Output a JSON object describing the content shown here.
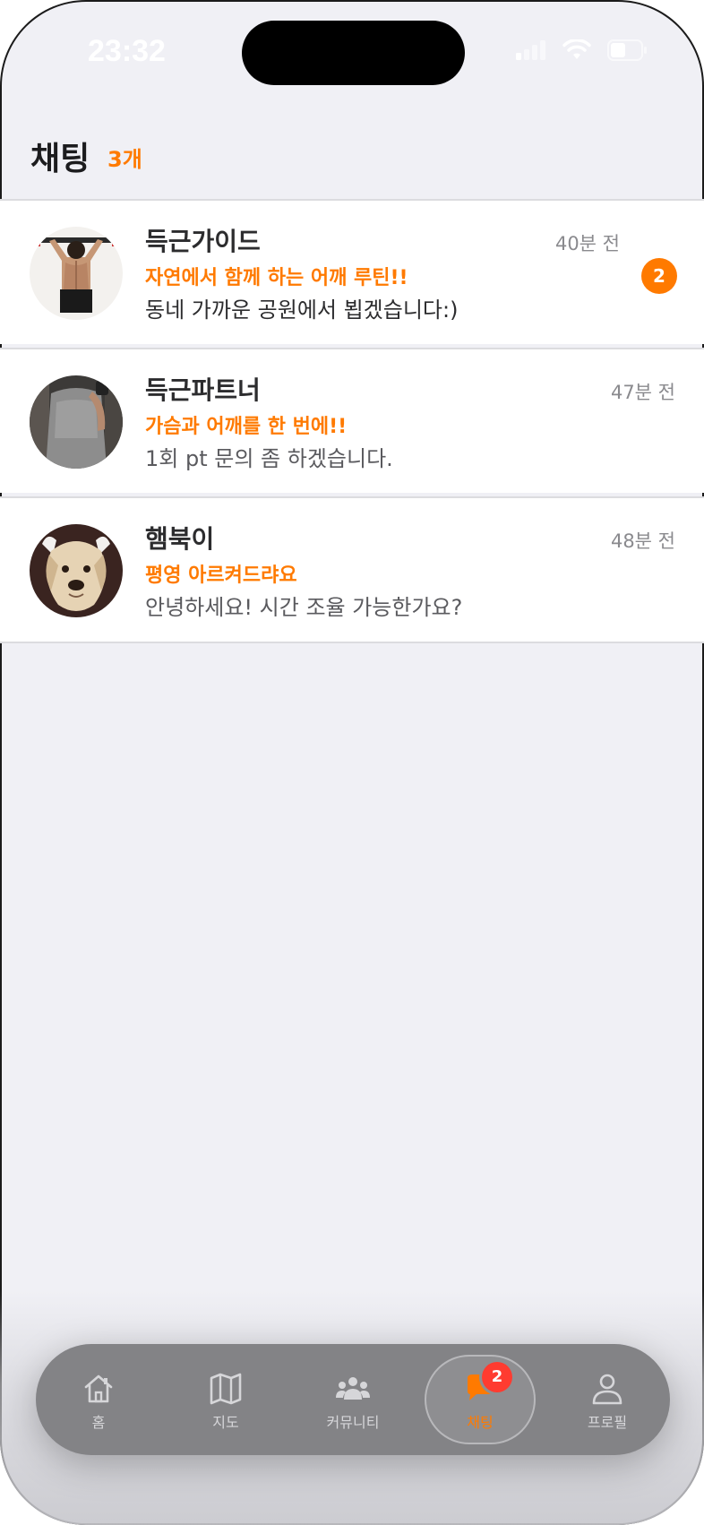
{
  "status_bar": {
    "time": "23:32"
  },
  "header": {
    "title": "채팅",
    "count": "3개"
  },
  "chats": [
    {
      "name": "득근가이드",
      "subtitle": "자연에서 함께 하는 어깨 루틴!!",
      "message": "동네 가까운 공원에서 뵙겠습니다:)",
      "time": "40분 전",
      "unread": "2"
    },
    {
      "name": "득근파트너",
      "subtitle": "가슴과 어깨를 한 번에!!",
      "message": "1회 pt 문의 좀 하겠습니다.",
      "time": "47분 전"
    },
    {
      "name": "햄북이",
      "subtitle": "평영 아르켜드랴요",
      "message": "안녕하세요! 시간 조율 가능한가요?",
      "time": "48분 전"
    }
  ],
  "tabbar": {
    "tabs": [
      {
        "label": "홈",
        "icon": "home-icon"
      },
      {
        "label": "지도",
        "icon": "map-icon"
      },
      {
        "label": "커뮤니티",
        "icon": "community-icon"
      },
      {
        "label": "채팅",
        "icon": "chat-icon",
        "badge": "2",
        "active": true
      },
      {
        "label": "프로필",
        "icon": "profile-icon"
      }
    ]
  },
  "colors": {
    "accent": "#ff7a00",
    "badge_red": "#ff3b30",
    "background": "#f0f0f5"
  }
}
